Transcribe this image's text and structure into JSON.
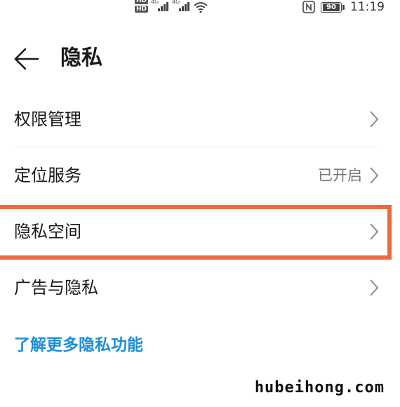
{
  "status_bar": {
    "network_badge_1": "HD",
    "network_badge_2": "HD",
    "signal_1": "4G",
    "signal_2": "4G",
    "battery_level": "90",
    "time": "11:19"
  },
  "header": {
    "back_icon": "arrow-left-icon",
    "title": "隐私"
  },
  "settings": {
    "items": [
      {
        "label": "权限管理",
        "value": ""
      },
      {
        "label": "定位服务",
        "value": "已开启"
      },
      {
        "label": "隐私空间",
        "value": ""
      },
      {
        "label": "广告与隐私",
        "value": ""
      }
    ]
  },
  "learn_more": "了解更多隐私功能",
  "watermark": "hubeihong.com",
  "colors": {
    "link": "#1f8fd6",
    "highlight": "#ee6a3c"
  }
}
